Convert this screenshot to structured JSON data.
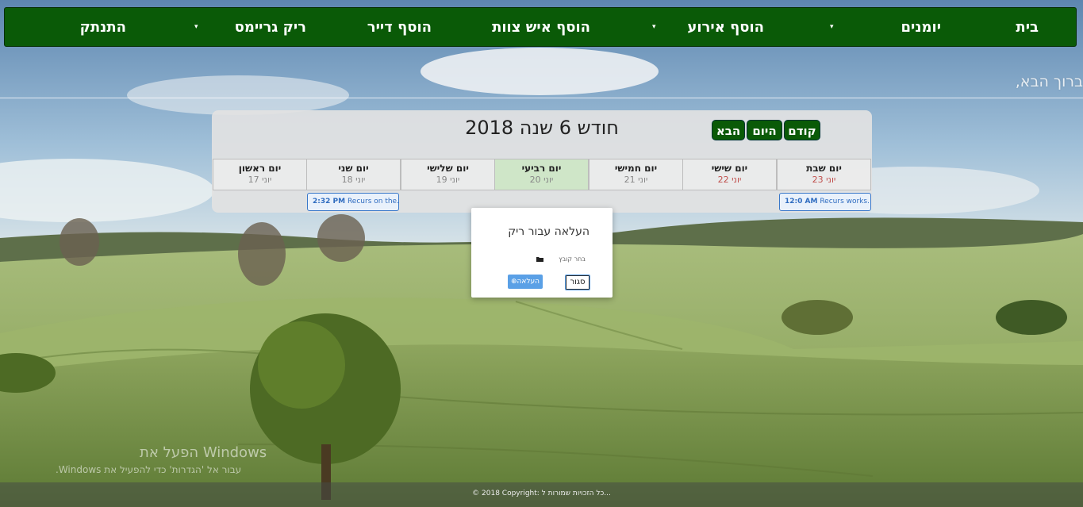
{
  "navbar": {
    "items": [
      {
        "label": "בית"
      },
      {
        "label": "יומנים"
      },
      {
        "label": "הוסף אירוע"
      },
      {
        "label": "הוסף איש צוות"
      },
      {
        "label": "הוסף דייר"
      },
      {
        "label": "ריק גריימס"
      },
      {
        "label": "התנתק"
      }
    ],
    "caret_glyph": "▾"
  },
  "welcome": "ברוך הבא,",
  "calendar": {
    "title": "חודש 6 שנה 2018",
    "buttons": {
      "prev": "קודם",
      "today": "היום",
      "next": "הבא"
    },
    "days": [
      {
        "name": "יום שבת",
        "date": "יוני 23"
      },
      {
        "name": "יום שישי",
        "date": "יוני 22"
      },
      {
        "name": "יום חמישי",
        "date": "יוני 21"
      },
      {
        "name": "יום רביעי",
        "date": "יוני 20"
      },
      {
        "name": "יום שלישי",
        "date": "יוני 19"
      },
      {
        "name": "יום שני",
        "date": "יוני 18"
      },
      {
        "name": "יום ראשון",
        "date": "יוני 17"
      }
    ],
    "events": [
      {
        "time": "12:0 AM",
        "text": "Recurs works..."
      },
      {
        "time": "2:32 PM",
        "text": "Recurs on the..."
      }
    ]
  },
  "modal": {
    "title": "העלאה עבור ריק",
    "file_label": "בחר קובץ",
    "upload_label": "העלאה",
    "close_label": "סגור"
  },
  "watermark": {
    "line1": "הפעל את Windows",
    "line2": "עבור אל 'הגדרות' כדי להפעיל את Windows."
  },
  "footer": "© 2018 Copyright: כל הזכויות שמורות ל..."
}
